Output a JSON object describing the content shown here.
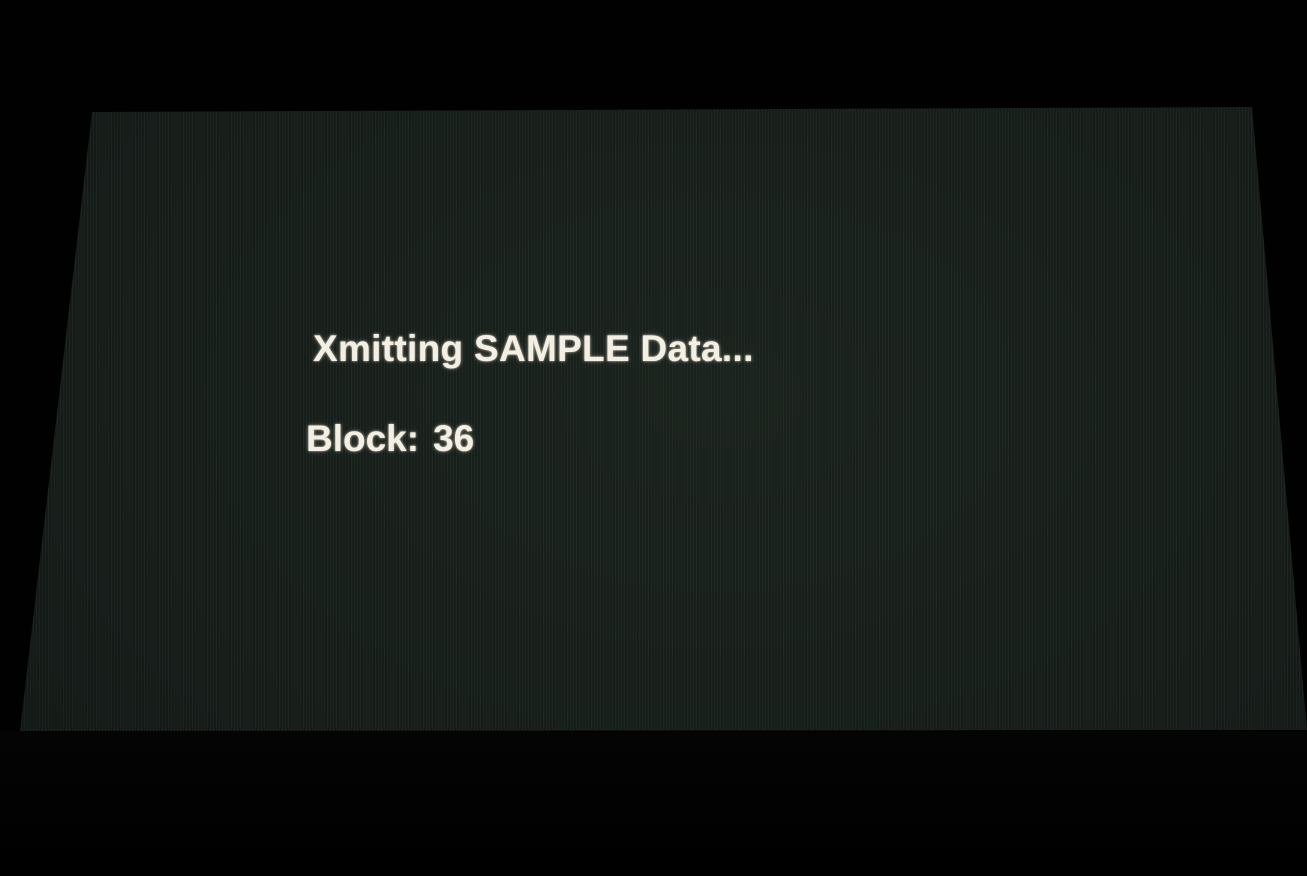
{
  "screen": {
    "title": "Xmitting SAMPLE Data...",
    "block_label": "Block:",
    "block_value": "36"
  },
  "colors": {
    "screen_background": "#161d19",
    "text": "#f4efe4",
    "bezel": "#000000"
  }
}
